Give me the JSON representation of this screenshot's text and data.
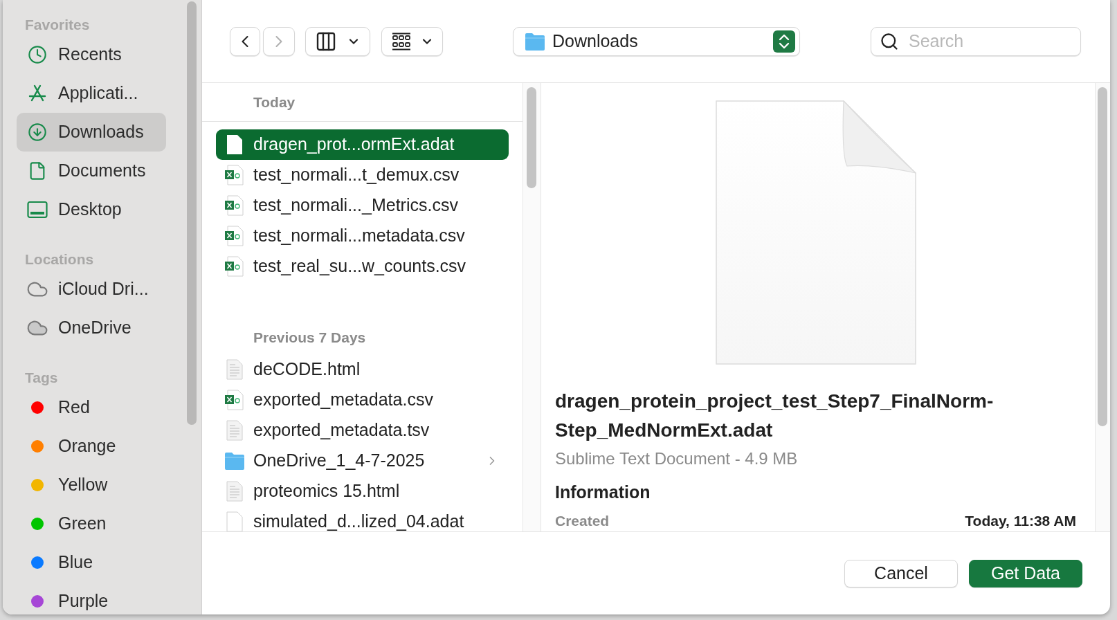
{
  "sidebar": {
    "sections": [
      {
        "title": "Favorites",
        "items": [
          {
            "label": "Recents",
            "kind": "clock",
            "selected": false
          },
          {
            "label": "Applicati...",
            "kind": "apps",
            "selected": false
          },
          {
            "label": "Downloads",
            "kind": "download",
            "selected": true
          },
          {
            "label": "Documents",
            "kind": "document",
            "selected": false
          },
          {
            "label": "Desktop",
            "kind": "desktop",
            "selected": false
          }
        ]
      },
      {
        "title": "Locations",
        "items": [
          {
            "label": "iCloud Dri...",
            "kind": "cloud",
            "selected": false
          },
          {
            "label": "OneDrive",
            "kind": "cloud-filled",
            "selected": false
          }
        ]
      },
      {
        "title": "Tags",
        "items": [
          {
            "label": "Red",
            "kind": "tag",
            "color": "#ff0000",
            "selected": false
          },
          {
            "label": "Orange",
            "kind": "tag",
            "color": "#ff7f00",
            "selected": false
          },
          {
            "label": "Yellow",
            "kind": "tag",
            "color": "#f2b600",
            "selected": false
          },
          {
            "label": "Green",
            "kind": "tag",
            "color": "#00c500",
            "selected": false
          },
          {
            "label": "Blue",
            "kind": "tag",
            "color": "#0a7aff",
            "selected": false
          },
          {
            "label": "Purple",
            "kind": "tag",
            "color": "#a646d6",
            "selected": false
          }
        ]
      }
    ]
  },
  "toolbar": {
    "location": "Downloads",
    "search": {
      "placeholder": "Search"
    }
  },
  "file_list": {
    "groups": [
      {
        "title": "Today",
        "files": [
          {
            "name": "dragen_prot...ormExt.adat",
            "kind": "blank",
            "selected": true,
            "expandable": false
          },
          {
            "name": "test_normali...t_demux.csv",
            "kind": "spreadsheet",
            "selected": false,
            "expandable": false
          },
          {
            "name": "test_normali..._Metrics.csv",
            "kind": "spreadsheet",
            "selected": false,
            "expandable": false
          },
          {
            "name": "test_normali...metadata.csv",
            "kind": "spreadsheet",
            "selected": false,
            "expandable": false
          },
          {
            "name": "test_real_su...w_counts.csv",
            "kind": "spreadsheet",
            "selected": false,
            "expandable": false
          }
        ]
      },
      {
        "title": "Previous 7 Days",
        "files": [
          {
            "name": "deCODE.html",
            "kind": "text",
            "selected": false,
            "expandable": false
          },
          {
            "name": "exported_metadata.csv",
            "kind": "spreadsheet",
            "selected": false,
            "expandable": false
          },
          {
            "name": "exported_metadata.tsv",
            "kind": "text",
            "selected": false,
            "expandable": false
          },
          {
            "name": "OneDrive_1_4-7-2025",
            "kind": "folder",
            "selected": false,
            "expandable": true
          },
          {
            "name": "proteomics 15.html",
            "kind": "text",
            "selected": false,
            "expandable": false
          },
          {
            "name": "simulated_d...lized_04.adat",
            "kind": "blank",
            "selected": false,
            "expandable": false
          }
        ]
      }
    ]
  },
  "preview": {
    "title": "dragen_protein_project_test_Step7_FinalNorm-Step_MedNormExt.adat",
    "subtitle": "Sublime Text Document - 4.9 MB",
    "section": "Information",
    "rows": [
      {
        "label": "Created",
        "value": "Today, 11:38 AM"
      }
    ]
  },
  "buttons": [
    {
      "label": "Cancel",
      "kind": "secondary"
    },
    {
      "label": "Get Data",
      "kind": "primary"
    }
  ]
}
